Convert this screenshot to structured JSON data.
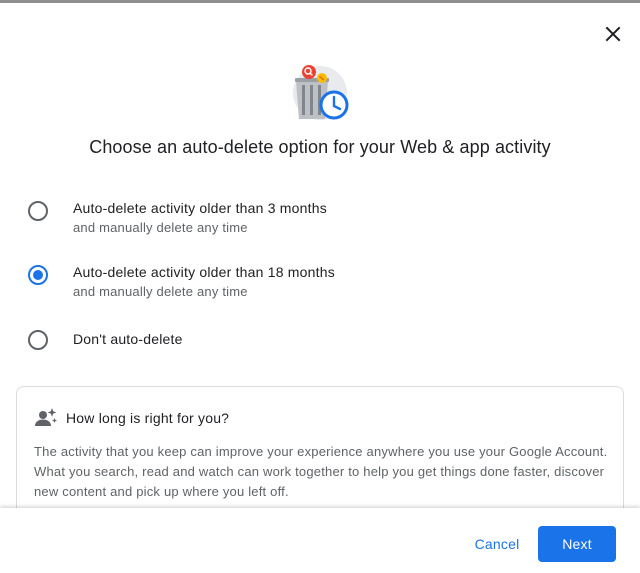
{
  "dialog": {
    "title": "Choose an auto-delete option for your Web & app activity",
    "close_icon": "close-icon",
    "illustration_icon": "auto-delete-bin-clock-illustration"
  },
  "options": [
    {
      "title": "Auto-delete activity older than 3 months",
      "subtitle": "and manually delete any time",
      "selected": false
    },
    {
      "title": "Auto-delete activity older than 18 months",
      "subtitle": "and manually delete any time",
      "selected": true
    },
    {
      "title": "Don't auto-delete",
      "subtitle": "",
      "selected": false
    }
  ],
  "info": {
    "icon": "person-sparkle-icon",
    "heading": "How long is right for you?",
    "body": "The activity that you keep can improve your experience anywhere you use your Google Account. What you search, read and watch can work together to help you get things done faster, discover new content and pick up where you left off."
  },
  "footer": {
    "cancel_label": "Cancel",
    "next_label": "Next"
  },
  "colors": {
    "accent": "#1a73e8",
    "title_text": "#202124",
    "secondary_text": "#5f6368"
  }
}
